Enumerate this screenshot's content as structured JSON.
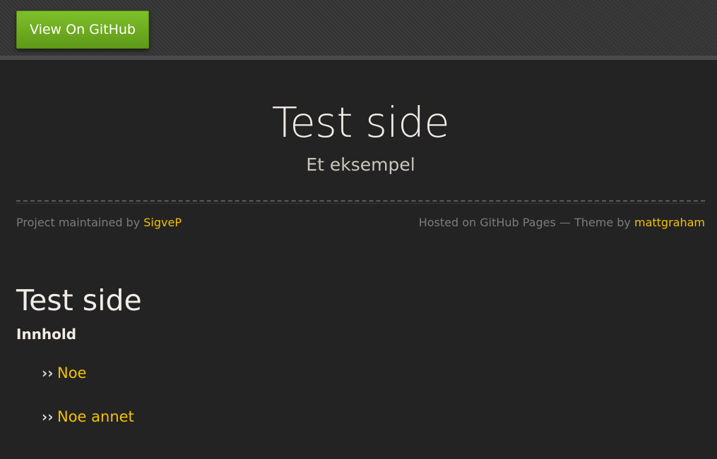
{
  "topbar": {
    "github_button_label": "View On GitHub"
  },
  "header": {
    "title": "Test side",
    "subtitle": "Et eksempel",
    "maintained_prefix": "Project maintained by ",
    "maintainer": "SigveP",
    "hosted_text": "Hosted on GitHub Pages — Theme by ",
    "theme_author": "mattgraham"
  },
  "content": {
    "heading": "Test side",
    "subheading": "Innhold",
    "list_items": [
      {
        "bullet": "››",
        "label": "Noe"
      },
      {
        "bullet": "››",
        "label": "Noe annet"
      }
    ]
  },
  "colors": {
    "background": "#232323",
    "accent_link": "#f2c200",
    "button_green": "#6aab1f"
  }
}
